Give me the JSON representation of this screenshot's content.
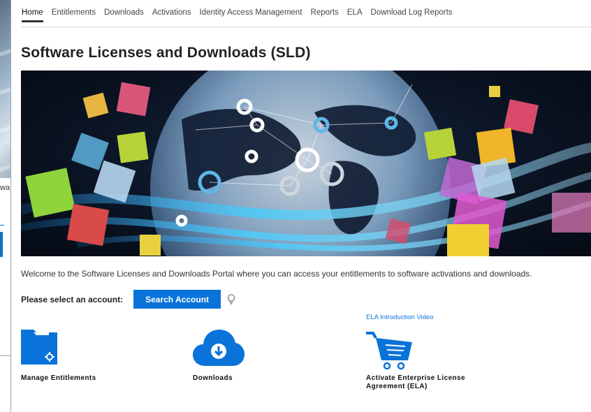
{
  "background_window": {
    "fragment_text": "wa"
  },
  "nav": {
    "items": [
      {
        "label": "Home",
        "active": true
      },
      {
        "label": "Entitlements"
      },
      {
        "label": "Downloads"
      },
      {
        "label": "Activations"
      },
      {
        "label": "Identity Access Management"
      },
      {
        "label": "Reports"
      },
      {
        "label": "ELA"
      },
      {
        "label": "Download Log Reports"
      }
    ]
  },
  "page": {
    "title": "Software Licenses and Downloads (SLD)",
    "welcome": "Welcome to the Software Licenses and Downloads Portal where you can access your entitlements to software activations and downloads."
  },
  "account": {
    "label": "Please select an account:",
    "button_label": "Search Account",
    "hint_icon": "lightbulb-icon"
  },
  "tiles": {
    "ela_video_link": "ELA Introduction Video",
    "manage": {
      "label": "Manage Entitlements",
      "icon": "folder-gear-icon"
    },
    "downloads": {
      "label": "Downloads",
      "icon": "cloud-download-icon"
    },
    "ela": {
      "label": "Activate Enterprise License Agreement (ELA)",
      "icon": "shopping-cart-icon"
    }
  },
  "colors": {
    "accent": "#0a73d9",
    "icon_blue": "#0a73d9",
    "banner_dark": "#0a1322"
  }
}
